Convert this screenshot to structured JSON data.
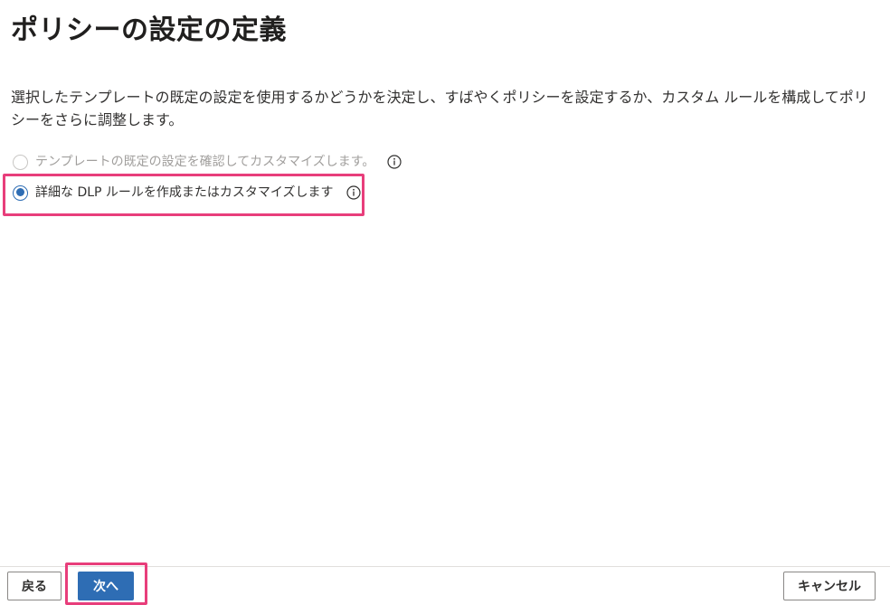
{
  "page": {
    "title": "ポリシーの設定の定義",
    "description": "選択したテンプレートの既定の設定を使用するかどうかを決定し、すばやくポリシーを設定するか、カスタム ルールを構成してポリシーをさらに調整します。"
  },
  "options": [
    {
      "label": "テンプレートの既定の設定を確認してカスタマイズします。",
      "selected": false,
      "disabled": true,
      "icon": "info-icon"
    },
    {
      "label": "詳細な DLP ルールを作成またはカスタマイズします",
      "selected": true,
      "disabled": false,
      "icon": "info-icon"
    }
  ],
  "footer": {
    "back_label": "戻る",
    "next_label": "次へ",
    "cancel_label": "キャンセル"
  },
  "colors": {
    "accent": "#2e6db4",
    "highlight": "#e83e7b",
    "disabled_text": "#a19f9d"
  }
}
